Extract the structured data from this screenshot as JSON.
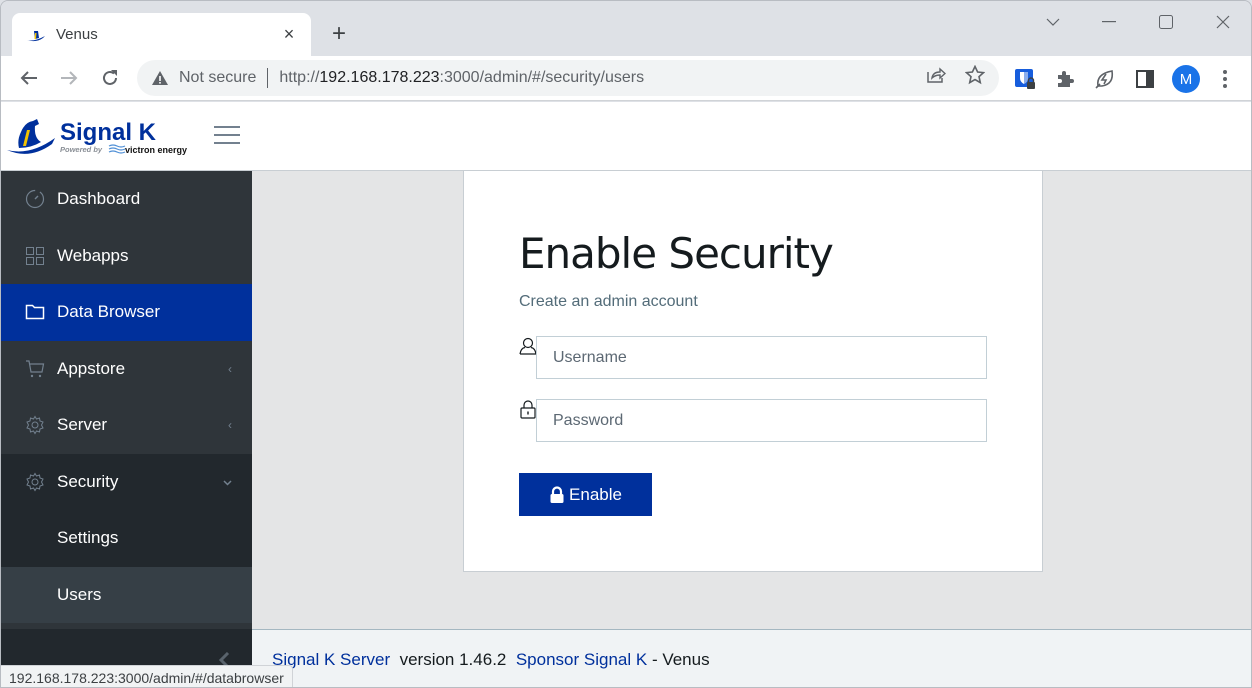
{
  "browser": {
    "tab": {
      "title": "Venus",
      "favicon": "signalk-boat-icon",
      "close": "×"
    },
    "new_tab": "+",
    "window_controls": [
      "chevron-down-icon",
      "minimize-icon",
      "maximize-icon",
      "close-icon"
    ],
    "address": {
      "security_label": "Not secure",
      "url_scheme": "http://",
      "url_host": "192.168.178.223",
      "url_rest": ":3000/admin/#/security/users"
    },
    "extensions": [
      "bitwarden-icon",
      "puzzle-icon",
      "leaf-bolt-icon",
      "sidepanel-icon"
    ],
    "profile_initial": "M",
    "status_url": "192.168.178.223:3000/admin/#/databrowser"
  },
  "app": {
    "logo": {
      "name": "Signal K",
      "powered_by": "Powered by",
      "partner": "victron energy"
    },
    "sidebar": {
      "items": [
        {
          "label": "Dashboard",
          "icon": "speedometer-icon"
        },
        {
          "label": "Webapps",
          "icon": "grid-icon"
        },
        {
          "label": "Data Browser",
          "icon": "folder-icon",
          "active": true
        },
        {
          "label": "Appstore",
          "icon": "cart-icon",
          "caret": "‹"
        },
        {
          "label": "Server",
          "icon": "gear-icon",
          "caret": "‹"
        },
        {
          "label": "Security",
          "icon": "gear-icon",
          "caret": "⌄",
          "children": [
            {
              "label": "Settings"
            },
            {
              "label": "Users",
              "current": true
            }
          ]
        }
      ],
      "minimizer": "‹"
    },
    "main": {
      "title": "Enable Security",
      "subtitle": "Create an admin account",
      "username": {
        "placeholder": "Username",
        "value": ""
      },
      "password": {
        "placeholder": "Password",
        "value": ""
      },
      "enable_button": "Enable"
    },
    "footer": {
      "server_link": "Signal K Server",
      "version": "version 1.46.2",
      "sponsor_link": "Sponsor Signal K",
      "suffix": "- Venus"
    },
    "colors": {
      "primary": "#00309c",
      "sidebar": "#2f353a",
      "sidebar_dark": "#22282d"
    }
  }
}
